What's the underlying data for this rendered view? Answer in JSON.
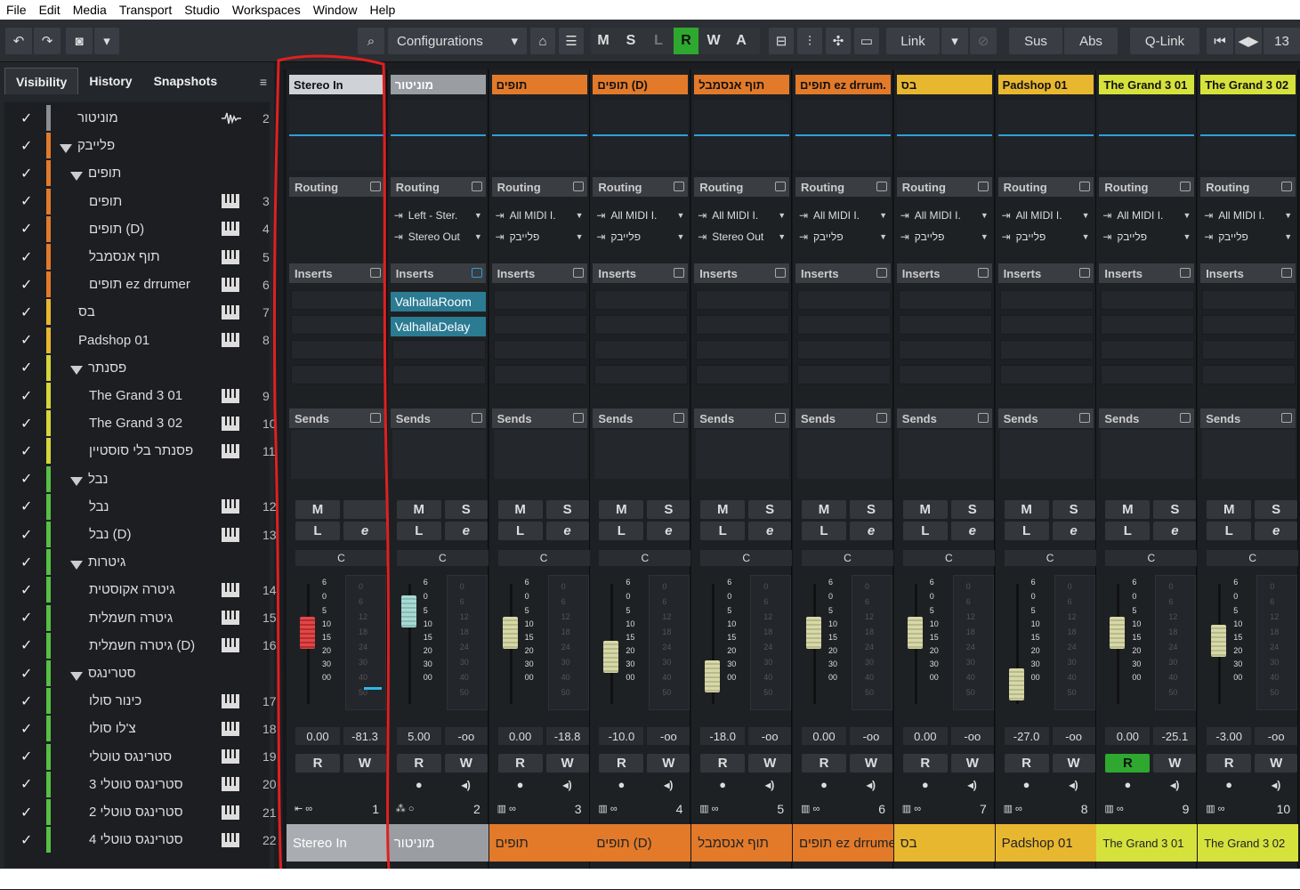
{
  "menu": [
    "File",
    "Edit",
    "Media",
    "Transport",
    "Studio",
    "Workspaces",
    "Window",
    "Help"
  ],
  "toolbar": {
    "configurations": "Configurations",
    "modes": [
      "M",
      "S",
      "L",
      "R",
      "W",
      "A"
    ],
    "link": "Link",
    "sus": "Sus",
    "abs": "Abs",
    "qlink": "Q-Link",
    "count": "13"
  },
  "left_panel": {
    "tabs": [
      "Visibility",
      "History",
      "Snapshots"
    ],
    "tracks": [
      {
        "name": "מוניטור",
        "color": "#8a8d91",
        "indent": 0,
        "folder": false,
        "num": "2",
        "type": "audio"
      },
      {
        "name": "פלייבק",
        "color": "#e27a2a",
        "indent": 0,
        "folder": true,
        "num": "",
        "type": ""
      },
      {
        "name": "תופים",
        "color": "#e27a2a",
        "indent": 1,
        "folder": true,
        "num": "",
        "type": ""
      },
      {
        "name": "תופים",
        "color": "#e27a2a",
        "indent": 2,
        "folder": false,
        "num": "3",
        "type": "midi"
      },
      {
        "name": "תופים (D)",
        "color": "#e27a2a",
        "indent": 2,
        "folder": false,
        "num": "4",
        "type": "midi"
      },
      {
        "name": "תוף אנסמבל",
        "color": "#e27a2a",
        "indent": 2,
        "folder": false,
        "num": "5",
        "type": "midi"
      },
      {
        "name": "תופים ez drrumer",
        "color": "#e27a2a",
        "indent": 2,
        "folder": false,
        "num": "6",
        "type": "midi"
      },
      {
        "name": "בס",
        "color": "#e8b730",
        "indent": 1,
        "folder": false,
        "num": "7",
        "type": "midi"
      },
      {
        "name": "Padshop 01",
        "color": "#e8b730",
        "indent": 1,
        "folder": false,
        "num": "8",
        "type": "midi"
      },
      {
        "name": "פסנתר",
        "color": "#d4d63a",
        "indent": 1,
        "folder": true,
        "num": "",
        "type": ""
      },
      {
        "name": "The Grand 3 01",
        "color": "#d4d63a",
        "indent": 2,
        "folder": false,
        "num": "9",
        "type": "midi"
      },
      {
        "name": "The Grand 3 02",
        "color": "#d4d63a",
        "indent": 2,
        "folder": false,
        "num": "10",
        "type": "midi"
      },
      {
        "name": "פסנתר בלי סוסטיין",
        "color": "#d4d63a",
        "indent": 2,
        "folder": false,
        "num": "11",
        "type": "midi"
      },
      {
        "name": "נבל",
        "color": "#55c043",
        "indent": 1,
        "folder": true,
        "num": "",
        "type": ""
      },
      {
        "name": "נבל",
        "color": "#55c043",
        "indent": 2,
        "folder": false,
        "num": "12",
        "type": "midi"
      },
      {
        "name": "נבל (D)",
        "color": "#55c043",
        "indent": 2,
        "folder": false,
        "num": "13",
        "type": "midi"
      },
      {
        "name": "גיטרות",
        "color": "#55c043",
        "indent": 1,
        "folder": true,
        "num": "",
        "type": ""
      },
      {
        "name": "גיטרה אקוסטית",
        "color": "#55c043",
        "indent": 2,
        "folder": false,
        "num": "14",
        "type": "midi"
      },
      {
        "name": "גיטרה חשמלית",
        "color": "#55c043",
        "indent": 2,
        "folder": false,
        "num": "15",
        "type": "midi"
      },
      {
        "name": "גיטרה חשמלית (D)",
        "color": "#55c043",
        "indent": 2,
        "folder": false,
        "num": "16",
        "type": "midi"
      },
      {
        "name": "סטרינגס",
        "color": "#55c043",
        "indent": 1,
        "folder": true,
        "num": "",
        "type": ""
      },
      {
        "name": "כינור סולו",
        "color": "#55c043",
        "indent": 2,
        "folder": false,
        "num": "17",
        "type": "midi"
      },
      {
        "name": "צ'לו סולו",
        "color": "#55c043",
        "indent": 2,
        "folder": false,
        "num": "18",
        "type": "midi"
      },
      {
        "name": "סטרינגס טוטלי",
        "color": "#55c043",
        "indent": 2,
        "folder": false,
        "num": "19",
        "type": "midi"
      },
      {
        "name": "סטרינגס טוטלי 3",
        "color": "#55c043",
        "indent": 2,
        "folder": false,
        "num": "20",
        "type": "midi"
      },
      {
        "name": "סטרינגס טוטלי 2",
        "color": "#55c043",
        "indent": 2,
        "folder": false,
        "num": "21",
        "type": "midi"
      },
      {
        "name": "סטרינגס טוטלי 4",
        "color": "#55c043",
        "indent": 2,
        "folder": false,
        "num": "22",
        "type": "midi"
      }
    ]
  },
  "mixer": {
    "section_labels": {
      "routing": "Routing",
      "inserts": "Inserts",
      "sends": "Sends"
    },
    "buttons": {
      "m": "M",
      "s": "S",
      "l": "L",
      "e": "e",
      "r": "R",
      "w": "W",
      "pan": "C"
    },
    "fader_scale": [
      "6",
      "0",
      "5",
      "10",
      "15",
      "20",
      "30",
      "00"
    ],
    "meter_scale": [
      "0",
      "6",
      "12",
      "18",
      "24",
      "30",
      "40",
      "50"
    ],
    "channels": [
      {
        "header": "Stereo In",
        "color": "#cfd2d6",
        "name_color": "#a9acb1",
        "in": "",
        "out": "",
        "inserts": [],
        "fader": "0.00",
        "meter": "-81.3",
        "fader_pos": 0.66,
        "has_s": false,
        "number": "1",
        "r_active": false
      },
      {
        "header": "מוניטור",
        "color": "#9a9da2",
        "name_color": "#9a9da2",
        "in": "Left - Ster.",
        "out": "Stereo Out",
        "inserts": [
          "ValhallaRoom",
          "ValhallaDelay"
        ],
        "fader": "5.00",
        "meter": "-oo",
        "fader_pos": 0.88,
        "has_s": true,
        "number": "2",
        "r_active": false
      },
      {
        "header": "תופים",
        "color": "#e27a2a",
        "name_color": "#e27a2a",
        "in": "All MIDI I.",
        "out": "פלייבק",
        "inserts": [],
        "fader": "0.00",
        "meter": "-18.8",
        "fader_pos": 0.66,
        "has_s": true,
        "number": "3",
        "r_active": false
      },
      {
        "header": "תופים (D)",
        "color": "#e27a2a",
        "name_color": "#e27a2a",
        "in": "All MIDI I.",
        "out": "פלייבק",
        "inserts": [],
        "fader": "-10.0",
        "meter": "-oo",
        "fader_pos": 0.42,
        "has_s": true,
        "number": "4",
        "r_active": false
      },
      {
        "header": "תוף אנסמבל",
        "color": "#e27a2a",
        "name_color": "#e27a2a",
        "in": "All MIDI I.",
        "out": "Stereo Out",
        "inserts": [],
        "fader": "-18.0",
        "meter": "-oo",
        "fader_pos": 0.22,
        "has_s": true,
        "number": "5",
        "r_active": false
      },
      {
        "header": "תופים ez drrum.",
        "color": "#e27a2a",
        "name_color": "#e27a2a",
        "in": "All MIDI I.",
        "out": "פלייבק",
        "inserts": [],
        "fader": "0.00",
        "meter": "-oo",
        "fader_pos": 0.66,
        "has_s": true,
        "number": "6",
        "r_active": false,
        "name": "תופים ez drrumer"
      },
      {
        "header": "בס",
        "color": "#e8b730",
        "name_color": "#e8b730",
        "in": "All MIDI I.",
        "out": "פלייבק",
        "inserts": [],
        "fader": "0.00",
        "meter": "-oo",
        "fader_pos": 0.66,
        "has_s": true,
        "number": "7",
        "r_active": false
      },
      {
        "header": "Padshop 01",
        "color": "#e8b730",
        "name_color": "#e8b730",
        "in": "All MIDI I.",
        "out": "פלייבק",
        "inserts": [],
        "fader": "-27.0",
        "meter": "-oo",
        "fader_pos": 0.14,
        "has_s": true,
        "number": "8",
        "r_active": false
      },
      {
        "header": "The Grand 3 01",
        "color": "#d6e23c",
        "name_color": "#d6e23c",
        "in": "All MIDI I.",
        "out": "פלייבק",
        "inserts": [],
        "fader": "0.00",
        "meter": "-25.1",
        "fader_pos": 0.66,
        "has_s": true,
        "number": "9",
        "r_active": true
      },
      {
        "header": "The Grand 3 02",
        "color": "#d6e23c",
        "name_color": "#d6e23c",
        "in": "All MIDI I.",
        "out": "פלייבק",
        "inserts": [],
        "fader": "-3.00",
        "meter": "-oo",
        "fader_pos": 0.58,
        "has_s": true,
        "number": "10",
        "r_active": false
      }
    ]
  }
}
